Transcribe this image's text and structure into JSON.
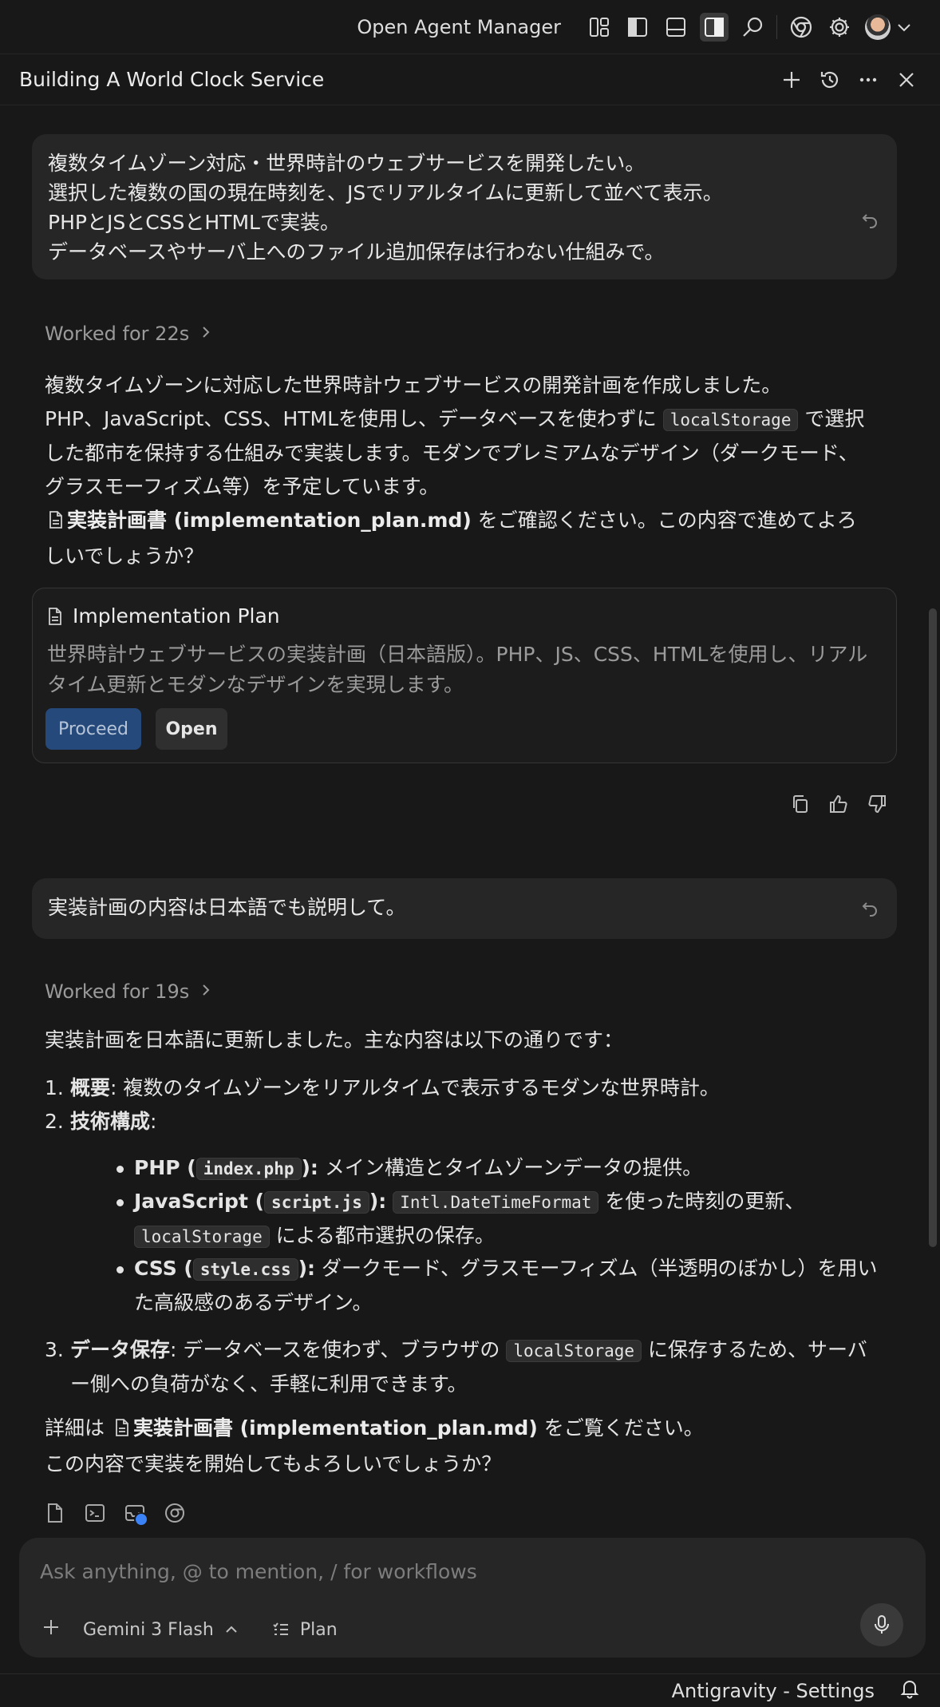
{
  "titlebar": {
    "app_name": "Open Agent Manager",
    "icons": [
      "layout-grid-icon",
      "sidebar-left-icon",
      "panel-bottom-icon",
      "sidebar-right-icon",
      "search-icon",
      "chrome-icon",
      "gear-icon",
      "avatar",
      "chevron-down-icon"
    ]
  },
  "panel": {
    "title": "Building A World Clock Service",
    "icons": [
      "plus-icon",
      "history-icon",
      "more-icon",
      "close-icon"
    ]
  },
  "conversation": {
    "user_message_1": [
      "複数タイムゾーン対応・世界時計のウェブサービスを開発したい。",
      "選択した複数の国の現在時刻を、JSでリアルタイムに更新して並べて表示。",
      "PHPとJSとCSSとHTMLで実装。",
      "データベースやサーバ上へのファイル追加保存は行わない仕組みで。"
    ],
    "worked_1": "Worked for 22s",
    "reply_1": {
      "line1": "複数タイムゾーンに対応した世界時計ウェブサービスの開発計画を作成しました。",
      "line2_pre": "PHP、JavaScript、CSS、HTMLを使用し、データベースを使わずに",
      "line2_code": "localStorage",
      "line2_post": "で選択した都市を保持する仕組みで実装します。モダンでプレミアムなデザイン（ダークモード、グラスモーフィズム等）を予定しています。",
      "file_link": "実装計画書 (implementation_plan.md)",
      "line3_post": "をご確認ください。この内容で進めてよろしいでしょうか？"
    },
    "card": {
      "title": "Implementation Plan",
      "description": "世界時計ウェブサービスの実装計画（日本語版）。PHP、JS、CSS、HTMLを使用し、リアルタイム更新とモダンなデザインを実現します。",
      "proceed_label": "Proceed",
      "open_label": "Open"
    },
    "user_message_2": "実装計画の内容は日本語でも説明して。",
    "worked_2": "Worked for 19s",
    "reply_2": {
      "intro": "実装計画を日本語に更新しました。主な内容は以下の通りです：",
      "item1_num": "1.",
      "item1_label": "概要",
      "item1_text": ": 複数のタイムゾーンをリアルタイムで表示するモダンな世界時計。",
      "item2_num": "2.",
      "item2_label": "技術構成",
      "item2_colon": ":",
      "php_label": "PHP (",
      "php_code": "index.php",
      "php_close": "):",
      "php_text": "メイン構造とタイムゾーンデータの提供。",
      "js_label": "JavaScript (",
      "js_code": "script.js",
      "js_close": "):",
      "js_code2": "Intl.DateTimeFormat",
      "js_text": "を使った時刻の更新、",
      "js_code3": "localStorage",
      "js_text2": "による都市選択の保存。",
      "css_label": "CSS (",
      "css_code": "style.css",
      "css_close": "):",
      "css_text": "ダークモード、グラスモーフィズム（半透明のぼかし）を用いた高級感のあるデザイン。",
      "item3_num": "3.",
      "item3_label": "データ保存",
      "item3_text": ": データベースを使わず、ブラウザの",
      "item3_code": "localStorage",
      "item3_text2": "に保存するため、サーバー側への負荷がなく、手軽に利用できます。",
      "detail_pre": "詳細は",
      "detail_link": "実装計画書 (implementation_plan.md)",
      "detail_post": "をご覧ください。",
      "closing": "この内容で実装を開始してもよろしいでしょうか？"
    }
  },
  "composer": {
    "placeholder": "Ask anything, @ to mention, / for workflows",
    "model": "Gemini 3 Flash",
    "mode": "Plan"
  },
  "statusbar": {
    "text": "Antigravity - Settings"
  },
  "colors": {
    "background": "#181818",
    "bubble": "#262627",
    "accent_button": "#25497a",
    "badge_dot": "#3b82f6"
  }
}
